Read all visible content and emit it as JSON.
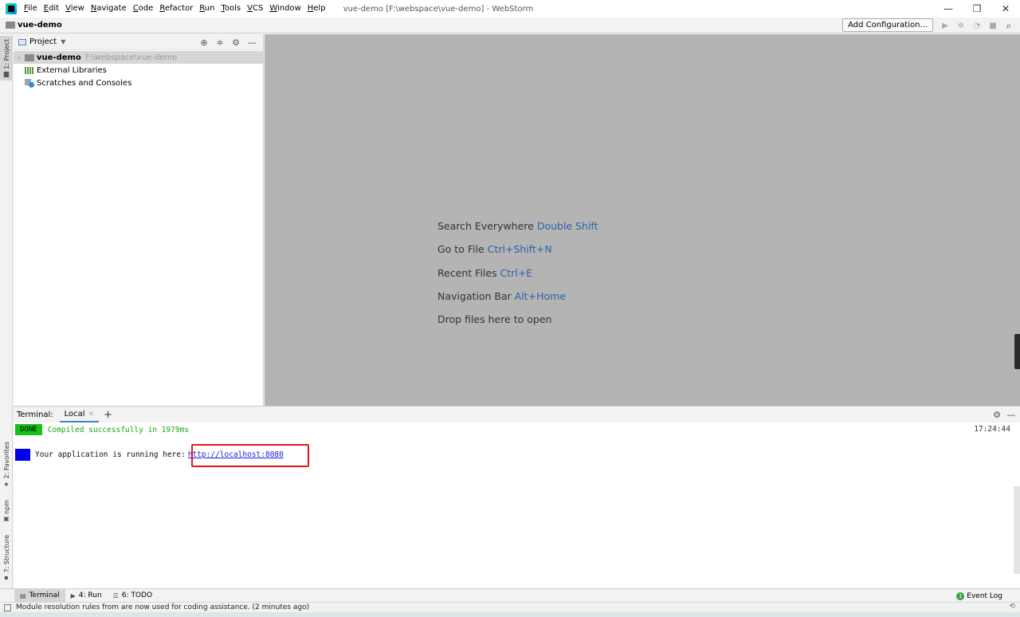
{
  "menu": {
    "items": [
      "File",
      "Edit",
      "View",
      "Navigate",
      "Code",
      "Refactor",
      "Run",
      "Tools",
      "VCS",
      "Window",
      "Help"
    ],
    "window_title": "vue-demo [F:\\webspace\\vue-demo] - WebStorm"
  },
  "window_controls": {
    "minimize": "—",
    "restore": "❐",
    "close": "✕"
  },
  "navbar": {
    "project_name": "vue-demo",
    "add_configuration": "Add Configuration..."
  },
  "left_stripe": {
    "project_tab": "1: Project",
    "favorites_tab": "2: Favorites",
    "npm_tab": "npm",
    "structure_tab": "7: Structure"
  },
  "project_panel": {
    "title": "Project",
    "tree": [
      {
        "label": "vue-demo",
        "path": "F:\\webspace\\vue-demo"
      },
      {
        "label": "External Libraries"
      },
      {
        "label": "Scratches and Consoles"
      }
    ]
  },
  "editor": {
    "hints": [
      {
        "text": "Search Everywhere",
        "key": "Double Shift"
      },
      {
        "text": "Go to File",
        "key": "Ctrl+Shift+N"
      },
      {
        "text": "Recent Files",
        "key": "Ctrl+E"
      },
      {
        "text": "Navigation Bar",
        "key": "Alt+Home"
      },
      {
        "text": "Drop files here to open",
        "key": ""
      }
    ]
  },
  "terminal": {
    "title": "Terminal:",
    "tab_label": "Local",
    "done_badge": "DONE",
    "compiled_text": "Compiled successfully in 1979ms",
    "time": "17:24:44",
    "running_text": "Your application is running here:",
    "url": "http://localhost:8080"
  },
  "bottom_tools": {
    "terminal": "Terminal",
    "run": "4: Run",
    "todo": "6: TODO",
    "event_log": "Event Log"
  },
  "status": {
    "message": "Module resolution rules from  are now used for coding assistance. (2 minutes ago)"
  },
  "colors": {
    "editor_bg": "#b4b4b4",
    "hint_key": "#2f5fa8",
    "done_green": "#17c117",
    "link_blue": "#1a1aee",
    "highlight_red": "#e0191f"
  }
}
